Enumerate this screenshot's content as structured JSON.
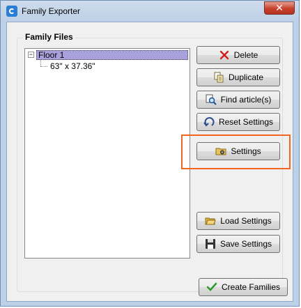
{
  "window": {
    "title": "Family Exporter"
  },
  "group": {
    "label": "Family Files"
  },
  "tree": {
    "expander": "−",
    "root": "Floor 1",
    "child": "63\" x 37.36\""
  },
  "buttons": {
    "delete": "Delete",
    "duplicate": "Duplicate",
    "find": "Find article(s)",
    "reset": "Reset Settings",
    "settings": "Settings",
    "load": "Load Settings",
    "save": "Save Settings",
    "create": "Create Families"
  },
  "icons": {
    "delete": "delete-x-icon",
    "duplicate": "duplicate-icon",
    "find": "find-search-icon",
    "reset": "reset-arrow-icon",
    "settings": "settings-folder-icon",
    "load": "folder-open-icon",
    "save": "floppy-disk-icon",
    "create": "checkmark-icon",
    "close": "close-x-icon"
  },
  "colors": {
    "highlight_box": "#f26522",
    "selected_tree_item": "#a9a1dc",
    "titlebar": "#bcd0e7",
    "close_button": "#c7402b"
  },
  "close_label": "✕"
}
